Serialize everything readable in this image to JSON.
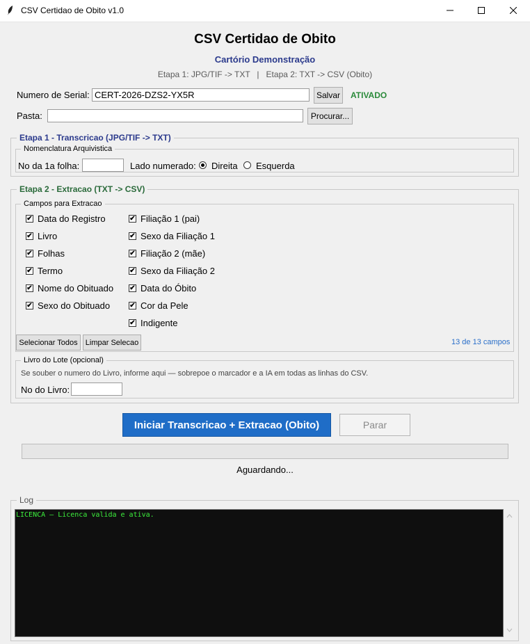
{
  "window": {
    "title": "CSV Certidao de Obito v1.0",
    "icon": "feather-icon",
    "controls": {
      "minimize": "—",
      "maximize": "☐",
      "close": "✕"
    }
  },
  "header": {
    "title": "CSV Certidao de Obito",
    "subtitle": "Cartório Demonstração",
    "steps": "Etapa 1: JPG/TIF -> TXT   |   Etapa 2: TXT -> CSV (Obito)"
  },
  "serial": {
    "label": "Numero de Serial:",
    "value": "CERT-2026-DZS2-YX5R",
    "save_label": "Salvar",
    "status": "ATIVADO"
  },
  "folder": {
    "label": "Pasta:",
    "value": "",
    "browse_label": "Procurar..."
  },
  "stage1": {
    "title": "Etapa 1 - Transcricao  (JPG/TIF -> TXT)",
    "nomenclature_title": "Nomenclatura Arquivistica",
    "first_sheet_label": "No da 1a folha:",
    "first_sheet_value": "",
    "side_label": "Lado numerado:",
    "side_options": [
      "Direita",
      "Esquerda"
    ],
    "side_selected": "Direita"
  },
  "stage2": {
    "title": "Etapa 2 - Extracao  (TXT -> CSV)",
    "fields_title": "Campos para Extracao",
    "fields_left": [
      {
        "label": "Data do Registro",
        "checked": true
      },
      {
        "label": "Livro",
        "checked": true
      },
      {
        "label": "Folhas",
        "checked": true
      },
      {
        "label": "Termo",
        "checked": true
      },
      {
        "label": "Nome do Obituado",
        "checked": true
      },
      {
        "label": "Sexo do Obituado",
        "checked": true
      }
    ],
    "fields_right": [
      {
        "label": "Filiação 1 (pai)",
        "checked": true
      },
      {
        "label": "Sexo da Filiação 1",
        "checked": true
      },
      {
        "label": "Filiação 2 (mãe)",
        "checked": true
      },
      {
        "label": "Sexo da Filiação 2",
        "checked": true
      },
      {
        "label": "Data do Óbito",
        "checked": true
      },
      {
        "label": "Cor da Pele",
        "checked": true
      },
      {
        "label": "Indigente",
        "checked": true
      }
    ],
    "select_all_label": "Selecionar Todos",
    "clear_label": "Limpar Selecao",
    "counter": "13 de 13 campos",
    "book_title": "Livro do Lote (opcional)",
    "book_info": "Se souber o numero do Livro, informe aqui — sobrepoe o marcador e a IA em todas as linhas do CSV.",
    "book_label": "No do Livro:",
    "book_value": ""
  },
  "actions": {
    "start_label": "Iniciar Transcricao + Extracao (Obito)",
    "stop_label": "Parar",
    "progress": 0,
    "status": "Aguardando..."
  },
  "log": {
    "title": "Log",
    "lines": [
      "LICENCA — Licenca valida e ativa."
    ]
  },
  "colors": {
    "accent": "#1f6dc7",
    "subtitle": "#2b3a8c",
    "stage2": "#2a6a3a",
    "activated": "#2a8a3a",
    "log_text": "#3cf03c",
    "log_bg": "#0f0f0f"
  }
}
